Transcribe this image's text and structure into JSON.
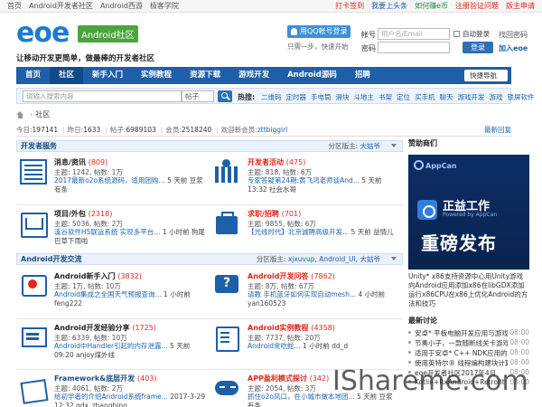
{
  "topbar": {
    "left": [
      "首页",
      "Android开发者社区",
      "Android西游",
      "极客学院"
    ],
    "right": [
      {
        "label": "打卡签到",
        "color": "red"
      },
      {
        "label": "我要上头条",
        "color": "blue"
      },
      {
        "label": "如何赚e币",
        "color": "green"
      },
      {
        "label": "注册验证问题",
        "color": "red"
      },
      {
        "label": "版主申请",
        "color": "red"
      }
    ]
  },
  "header": {
    "logo": "eoe",
    "logo_badge": "Android社区",
    "slogan": "让移动开发更简单，做最棒的开发者社区",
    "qq_login": "用QQ帐号登录",
    "qq_tip": "只需一步，快速开始",
    "login": {
      "account_label": "帐号",
      "account_placeholder": "用户名/Email",
      "password_label": "密码",
      "auto_login": "自动登录",
      "find_password": "找回密码",
      "login_button": "登录",
      "join": "加入eoe"
    }
  },
  "nav": {
    "items": [
      "首页",
      "社区",
      "新手入门",
      "实例教程",
      "资源下载",
      "游戏开发",
      "Android源码",
      "招聘"
    ],
    "active_index": 1,
    "quick_nav": "快捷导航"
  },
  "search": {
    "placeholder": "请输入搜索内容",
    "scope": "帖子",
    "hot_label": "热搜:",
    "hot": [
      "二维码",
      "定时器",
      "手电筒",
      "滑块",
      "斗地主",
      "书架",
      "定位",
      "买手机",
      "聊天",
      "游戏开发",
      "游戏",
      "锁屏软件"
    ]
  },
  "breadcrumb": {
    "current": "社区"
  },
  "stats": {
    "today_label": "今日:",
    "today": "197141",
    "yesterday_label": "昨日:",
    "yesterday": "1633",
    "posts_label": "帖子:",
    "posts": "6989103",
    "members_label": "会员:",
    "members": "2518240",
    "welcome": "欢迎新会员:",
    "newest": "zttbiggirl",
    "new_posts": "最新回复"
  },
  "sections": [
    {
      "title": "开发者服务",
      "mod_label": "分区版主:",
      "mod": "大姑爷",
      "boards": [
        {
          "icon": "news-icon",
          "name": "消息/资讯",
          "count": "(809)",
          "stat": "主题: 1242, 帖数: 1万",
          "last": "2017最新o2o系统源码，适用团购...",
          "time": "5 天前 豆浆有条"
        },
        {
          "icon": "event-icon",
          "name": "开发者活动",
          "count": "(475)",
          "stat": "主题: 818, 帖数: 6万",
          "last": "专家答疑第24期:黄飞鸿老师谈And...",
          "time": "5 天前 13:32 社会水哥"
        },
        {
          "icon": "project-icon",
          "name": "项目/外包",
          "count": "(2318)",
          "stat": "主题: 5036, 帖数: 2万",
          "last": "溪谷软件H5联运系统 实现多平台...",
          "time": "1 小时前 狗尾巴草下雨啦"
        },
        {
          "icon": "job-icon",
          "name": "求职/招聘",
          "count": "(701)",
          "stat": "主题: 9855, 帖数: 6万",
          "last": "【光线时代】北京诚聘高级开发...",
          "time": "5 天前 益情儿"
        }
      ]
    },
    {
      "title": "Android开发交流",
      "mod_label": "分区版主:",
      "mod": "xjxuvup, Android_UI, 大姑爷",
      "boards": [
        {
          "icon": "newbie-icon",
          "name": "Android新手入门",
          "count": "(3832)",
          "stat": "主题: 1万, 帖数: 10万",
          "last": "Android集成之全国天气预报查询...",
          "time": "1 小时前 feng222"
        },
        {
          "icon": "qa-icon",
          "name": "Android开发问答",
          "count": "(7862)",
          "stat": "主题: 8万, 帖数: 67万",
          "last": "请教 手机蓝牙如何实现自动mesh...",
          "time": "4 小时前 yan160523"
        },
        {
          "icon": "share-icon",
          "name": "Android开发经验分享",
          "count": "(1725)",
          "stat": "主题: 6339, 帖数: 10万",
          "last": "Android中Handler引起的内存泄露...",
          "time": "5 天前 09:20 anjoy煤外线"
        },
        {
          "icon": "tutorial-icon",
          "name": "Android实例教程",
          "count": "(4358)",
          "stat": "主题: 7737, 帖数: 20万",
          "last": "Android贪吃蛇...",
          "time": "1 小时前 dd_d"
        },
        {
          "icon": "framework-icon",
          "name": "Framework&底层开发",
          "count": "(403)",
          "stat": "主题: 4061, 帖数: 2万",
          "last": "给初学者的介绍Android系统frame...",
          "time": "2017-3-29 12:32 gdx_zhangbing"
        },
        {
          "icon": "game-icon",
          "name": "APP盈利模式探讨",
          "count": "(342)",
          "stat": "主题: 2054, 帖数: 3万",
          "last": "抓住o2o风口，在小城市做本地团...",
          "time": "5 天前 豆浆有条"
        }
      ]
    }
  ],
  "sidebar": {
    "sponsor_title": "赞助商们",
    "ad": {
      "brand": "AppCan",
      "line1": "正益工作",
      "line1_sub": "Powered by AppCan",
      "line2": "重磅发布"
    },
    "ad_text": "Unity* x86支持资源中心用Unity游戏向Android应用添加x86在libGDX添加运行x86CPU在x86上优化Android的方法和技巧",
    "latest_title": "最新讨论",
    "latest": [
      {
        "text": "安卓* 平板电脑开发应用与游戏",
        "time": "08:00"
      },
      {
        "text": "节奏小子，一款随断线关卡游戏",
        "time": "08:00"
      },
      {
        "text": "适用于安卓* C++ NDK应用的",
        "time": "08:00"
      },
      {
        "text": "使用英特尔® 线程编构建块计算",
        "time": "08:00"
      },
      {
        "text": "eoe开发者社区2017年4月",
        "time": "08:00"
      },
      {
        "text": "Kotlin+RxAndroid+Retrofit",
        "time": "08:00"
      }
    ]
  },
  "watermark": "IShareme.com"
}
